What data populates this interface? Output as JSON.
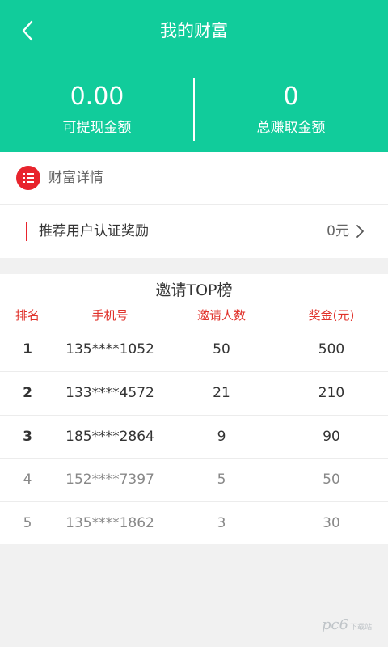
{
  "header": {
    "title": "我的财富",
    "withdrawable": {
      "value": "0.00",
      "label": "可提现金额"
    },
    "total_earned": {
      "value": "0",
      "label": "总赚取金额"
    }
  },
  "section": {
    "title": "财富详情"
  },
  "reward": {
    "label": "推荐用户认证奖励",
    "amount": "0元"
  },
  "top_board": {
    "title": "邀请TOP榜",
    "columns": [
      "排名",
      "手机号",
      "邀请人数",
      "奖金(元)"
    ],
    "rows": [
      {
        "rank": "1",
        "phone": "135****1052",
        "invites": "50",
        "bonus": "500"
      },
      {
        "rank": "2",
        "phone": "133****4572",
        "invites": "21",
        "bonus": "210"
      },
      {
        "rank": "3",
        "phone": "185****2864",
        "invites": "9",
        "bonus": "90"
      },
      {
        "rank": "4",
        "phone": "152****7397",
        "invites": "5",
        "bonus": "50"
      },
      {
        "rank": "5",
        "phone": "135****1862",
        "invites": "3",
        "bonus": "30"
      }
    ]
  },
  "watermark": {
    "text": "pc6",
    "sub": "下载站"
  },
  "colors": {
    "header_bg": "#11cc9b",
    "accent_red": "#e8242d",
    "column_red": "#e0322b"
  }
}
